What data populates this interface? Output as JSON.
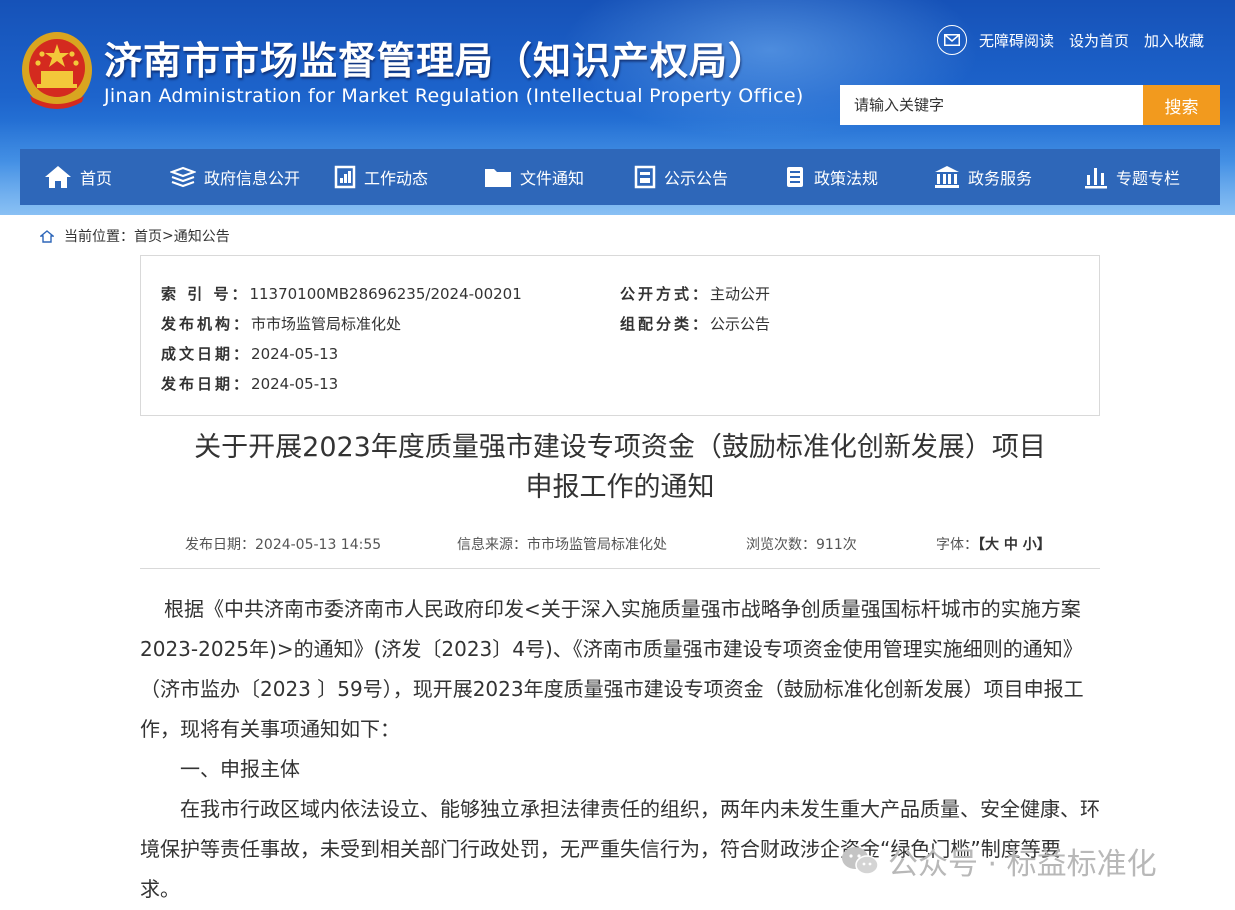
{
  "header": {
    "title_cn": "济南市市场监督管理局（知识产权局）",
    "title_en": "Jinan Administration for Market Regulation (Intellectual Property Office)",
    "toplinks": [
      "无障碍阅读",
      "设为首页",
      "加入收藏"
    ],
    "search_placeholder": "请输入关键字",
    "search_button": "搜索"
  },
  "nav": [
    {
      "label": "首页",
      "icon": "home-icon"
    },
    {
      "label": "政府信息公开",
      "icon": "books-icon"
    },
    {
      "label": "工作动态",
      "icon": "report-icon"
    },
    {
      "label": "文件通知",
      "icon": "folder-icon"
    },
    {
      "label": "公示公告",
      "icon": "board-icon"
    },
    {
      "label": "政策法规",
      "icon": "scroll-icon"
    },
    {
      "label": "政务服务",
      "icon": "building-icon"
    },
    {
      "label": "专题专栏",
      "icon": "bar-chart-icon"
    }
  ],
  "breadcrumb": {
    "prefix": "当前位置：",
    "home": "首页",
    "sep": ">",
    "current": "通知公告"
  },
  "meta": {
    "index_label": "索 引 号",
    "index_value": "11370100MB28696235/2024-00201",
    "org_label": "发布机构",
    "org_value": "市市场监管局标准化处",
    "created_label": "成文日期",
    "created_value": "2024-05-13",
    "published_label": "发布日期",
    "published_value": "2024-05-13",
    "mode_label": "公开方式",
    "mode_value": "主动公开",
    "category_label": "组配分类",
    "category_value": "公示公告"
  },
  "doc": {
    "title_line1": "关于开展2023年度质量强市建设专项资金（鼓励标准化创新发展）项目",
    "title_line2": "申报工作的通知",
    "publish_date": "发布日期：2024-05-13 14:55",
    "source": "信息来源：市市场监管局标准化处",
    "views": "浏览次数：911次",
    "font_label": "字体：",
    "font_options": "【大 中 小】",
    "para1": "根据《中共济南市委济南市人民政府印发<关于深入实施质量强市战略争创质量强国标杆城市的实施方案2023-2025年)>的通知》(济发〔2023〕4号)、《济南市质量强市建设专项资金使用管理实施细则的通知》（济市监办〔2023 〕59号），现开展2023年度质量强市建设专项资金（鼓励标准化创新发展）项目申报工作，现将有关事项通知如下：",
    "heading1": "一、申报主体",
    "para2": "在我市行政区域内依法设立、能够独立承担法律责任的组织，两年内未发生重大产品质量、安全健康、环境保护等责任事故，未受到相关部门行政处罚，无严重失信行为，符合财政涉企资金“绿色门槛”制度等要求。"
  },
  "watermark": "公众号 · 标益标准化"
}
